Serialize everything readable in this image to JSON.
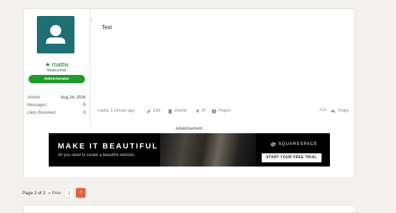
{
  "post": {
    "user": {
      "name": "mattw",
      "title": "Newcomer",
      "role": "Administrator",
      "stats": [
        {
          "label": "Joined:",
          "value": "Aug 24, 2016"
        },
        {
          "label": "Messages:",
          "value": "0"
        },
        {
          "label": "Likes Received:",
          "value": "0"
        }
      ]
    },
    "message": "Test",
    "meta": "mattw, 1 minute ago",
    "actions": {
      "edit": "Edit",
      "delete": "Delete",
      "ip": "IP",
      "report": "Report",
      "reply": "Reply"
    },
    "number": "#13"
  },
  "ad": {
    "label": "Advertisement",
    "headline": "MAKE IT BEAUTIFUL",
    "subtext": "All you need to create a beautiful website.",
    "brand": "SQUARESPACE",
    "cta": "START YOUR FREE TRIAL"
  },
  "pagination": {
    "info": "Page 2 of 2",
    "prev": "« Prev",
    "pages": [
      "1",
      "2"
    ],
    "current": "2"
  },
  "colors": {
    "accent": "#e8613f",
    "badge": "#1f9b2c",
    "avatar_bg": "#1f6f74",
    "username": "#247b34"
  },
  "icons": [
    "user-silhouette-icon",
    "star-icon",
    "pencil-icon",
    "trash-icon",
    "location-arrow-icon",
    "info-icon",
    "reply-icon",
    "squarespace-logo-icon"
  ]
}
